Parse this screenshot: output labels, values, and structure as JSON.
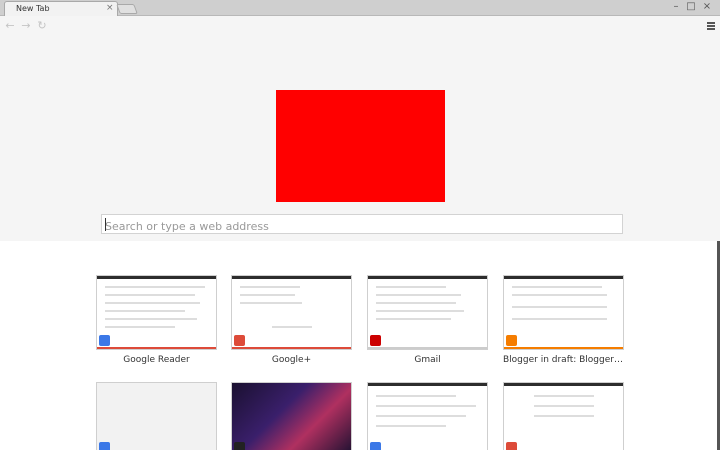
{
  "tab": {
    "title": "New Tab",
    "close": "×"
  },
  "window_controls": {
    "minimize": "–",
    "maximize": "□",
    "close": "×"
  },
  "toolbar": {
    "back": "←",
    "forward": "→",
    "reload": "↻"
  },
  "omnibox": {
    "placeholder": "Search or type a web address",
    "value": ""
  },
  "logo_color": "#ff0000",
  "most_visited": [
    {
      "title": "Google Reader",
      "accent": "#dd4b39",
      "favicon_color": "#3b78e7"
    },
    {
      "title": "Google+",
      "accent": "#dd4b39",
      "favicon_color": "#dd4b39"
    },
    {
      "title": "Gmail",
      "accent": "#cccccc",
      "favicon_color": "#cc0000"
    },
    {
      "title": "Blogger in draft: Blogger Dashboard",
      "accent": "#f57d00",
      "favicon_color": "#f57d00"
    },
    {
      "title": "",
      "accent": "#dddddd",
      "favicon_color": "#3b78e7"
    },
    {
      "title": "",
      "accent": "#333333",
      "favicon_color": "#222222"
    },
    {
      "title": "",
      "accent": "#dddddd",
      "favicon_color": "#3b78e7"
    },
    {
      "title": "",
      "accent": "#dddddd",
      "favicon_color": "#dd4b39"
    }
  ]
}
